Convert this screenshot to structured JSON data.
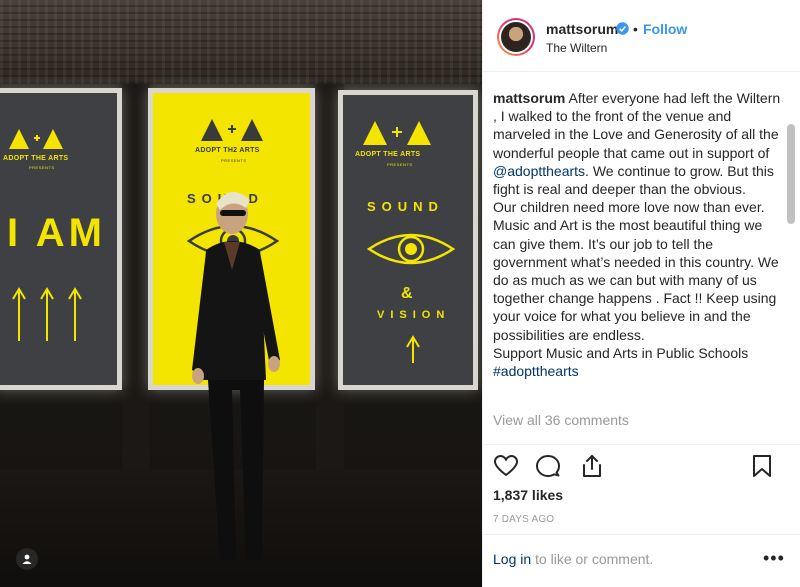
{
  "post": {
    "username": "mattsorum",
    "follow_label": "Follow",
    "separator": "•",
    "location": "The Wiltern",
    "caption": {
      "username": "mattsorum",
      "text_1": " After everyone had left the Wiltern , I walked to the front of the venue and marveled in the Love and Generosity of all the wonderful people that came out in support of ",
      "mention": "@adoptthearts",
      "text_2": ". We continue to grow. But this fight is real and deeper than the obvious.",
      "text_3": "Our children need more love now than ever. Music and Art is the most beautiful thing we can give them. It’s our job to tell the government what’s needed in this country. We do as much as we can but with many of us together change happens . Fact !! Keep using your voice for what you believe in and the possibilities are endless.",
      "text_4": "Support Music and Arts in Public Schools",
      "hashtag": "#adoptthearts"
    },
    "view_all_comments": "View all 36 comments",
    "likes": "1,837 likes",
    "timestamp": "7 DAYS AGO",
    "login_link": "Log in",
    "login_rest": " to like or comment.",
    "more_label": "•••"
  },
  "photo": {
    "poster_logo": "ADOPT THE ARTS",
    "poster_logo_mid": "ADOPT TH2 ARTS",
    "presents": "PRESENTS",
    "left_poster_text": "I AM",
    "sound": "SOUND",
    "vision": "VISION",
    "amp": "&"
  },
  "colors": {
    "follow": "#3897f0",
    "link": "#003569",
    "muted": "#999999",
    "poster_yellow": "#f3e500",
    "poster_gray": "#3e4044"
  },
  "icons": {
    "like": "heart-icon",
    "comment": "comment-icon",
    "share": "share-icon",
    "save": "bookmark-icon",
    "verified": "verified-badge-icon",
    "user_tag": "user-tag-icon"
  }
}
